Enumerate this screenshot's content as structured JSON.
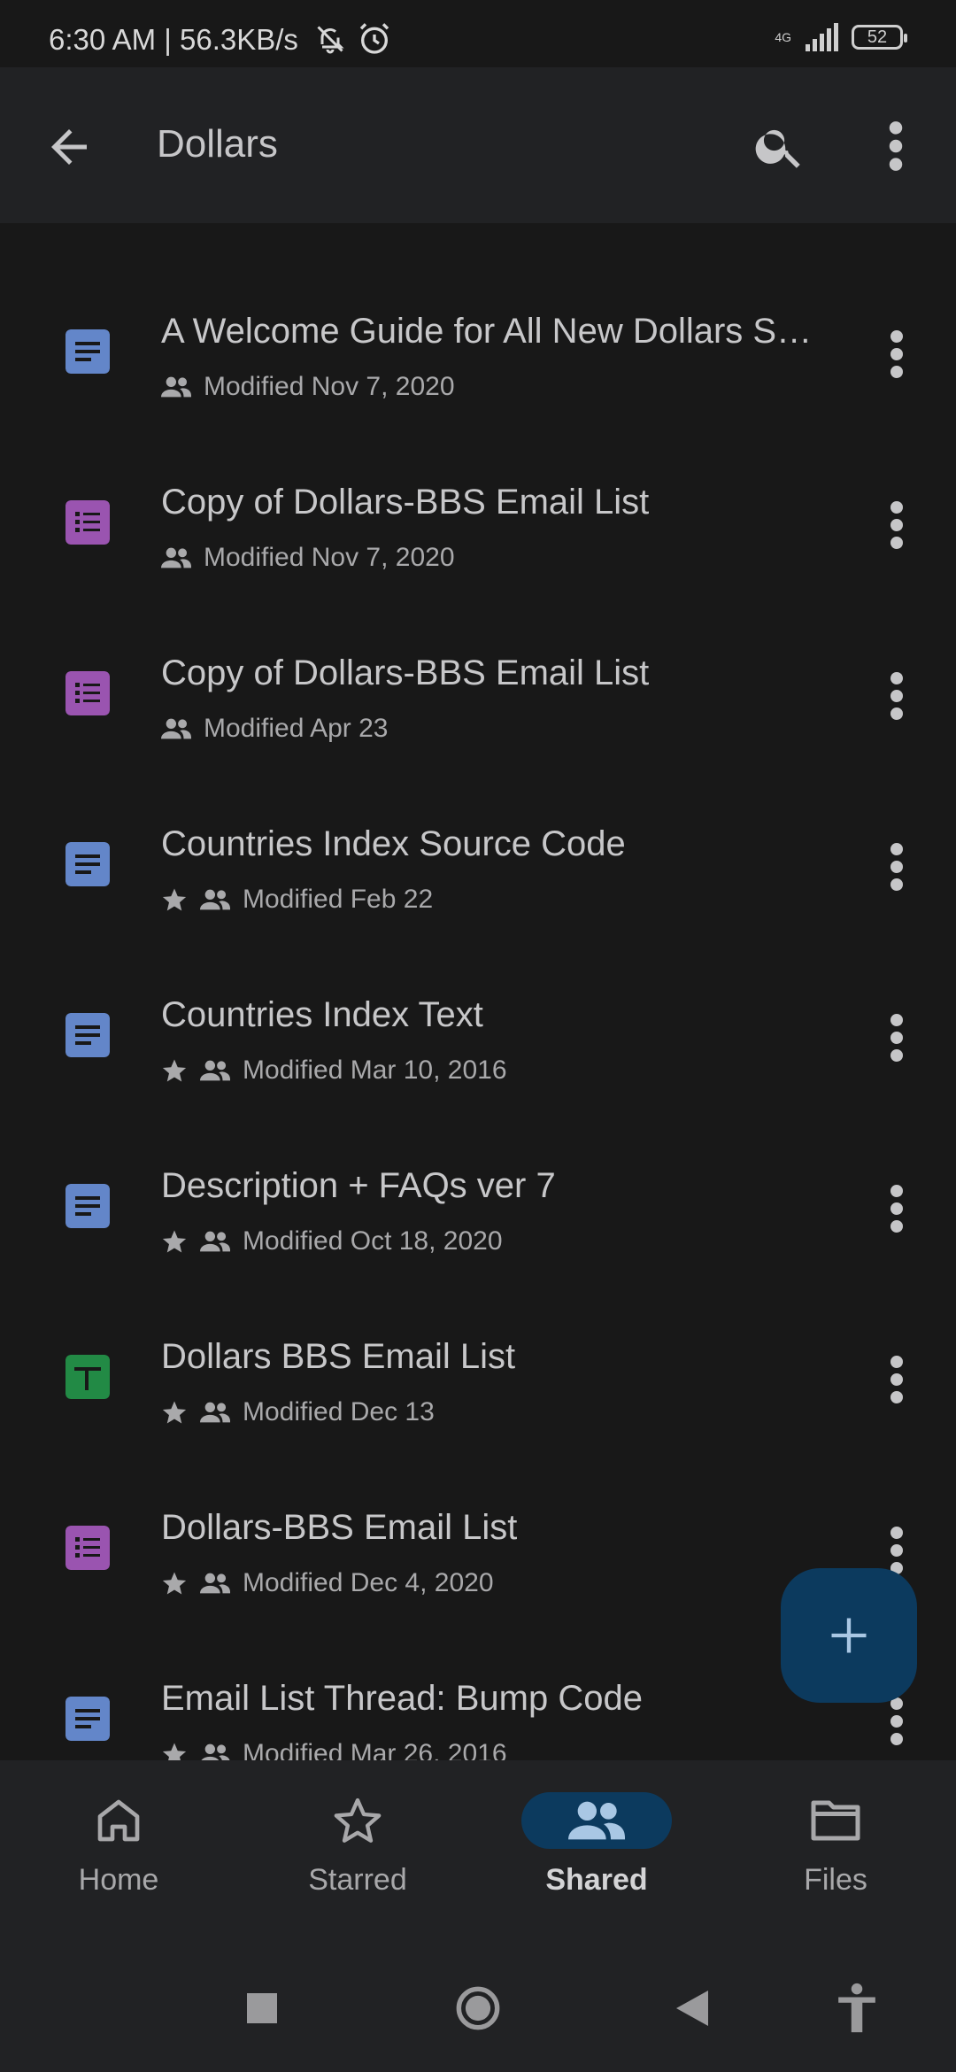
{
  "status_bar": {
    "time_text": "6:30 AM | 56.3KB/s",
    "network": "4G",
    "battery": "52"
  },
  "app_bar": {
    "title": "Dollars"
  },
  "files": [
    {
      "name": "A Welcome Guide for All New Dollars So...",
      "modified": "Modified Nov 7, 2020",
      "type": "doc",
      "starred": false
    },
    {
      "name": "Copy of Dollars-BBS Email List",
      "modified": "Modified Nov 7, 2020",
      "type": "form",
      "starred": false
    },
    {
      "name": "Copy of Dollars-BBS Email List",
      "modified": "Modified Apr 23",
      "type": "form",
      "starred": false
    },
    {
      "name": "Countries Index Source Code",
      "modified": "Modified Feb 22",
      "type": "doc",
      "starred": true
    },
    {
      "name": "Countries Index Text",
      "modified": "Modified Mar 10, 2016",
      "type": "doc",
      "starred": true
    },
    {
      "name": "Description + FAQs ver 7",
      "modified": "Modified Oct 18, 2020",
      "type": "doc",
      "starred": true
    },
    {
      "name": "Dollars BBS Email List",
      "modified": "Modified Dec 13",
      "type": "sheet",
      "starred": true
    },
    {
      "name": "Dollars-BBS Email List",
      "modified": "Modified Dec 4, 2020",
      "type": "form",
      "starred": true
    },
    {
      "name": "Email List Thread: Bump Code",
      "modified": "Modified Mar 26, 2016",
      "type": "doc",
      "starred": true
    }
  ],
  "file_type_colors": {
    "doc": "#6386c9",
    "form": "#9a54b0",
    "sheet": "#228a45"
  },
  "bottom_nav": {
    "items": [
      {
        "label": "Home",
        "icon": "home-icon"
      },
      {
        "label": "Starred",
        "icon": "star-outline-icon"
      },
      {
        "label": "Shared",
        "icon": "people-icon",
        "active": true
      },
      {
        "label": "Files",
        "icon": "folder-icon"
      }
    ]
  },
  "colors": {
    "background": "#181818",
    "bar": "#212224",
    "accent": "#0c3a5e"
  }
}
